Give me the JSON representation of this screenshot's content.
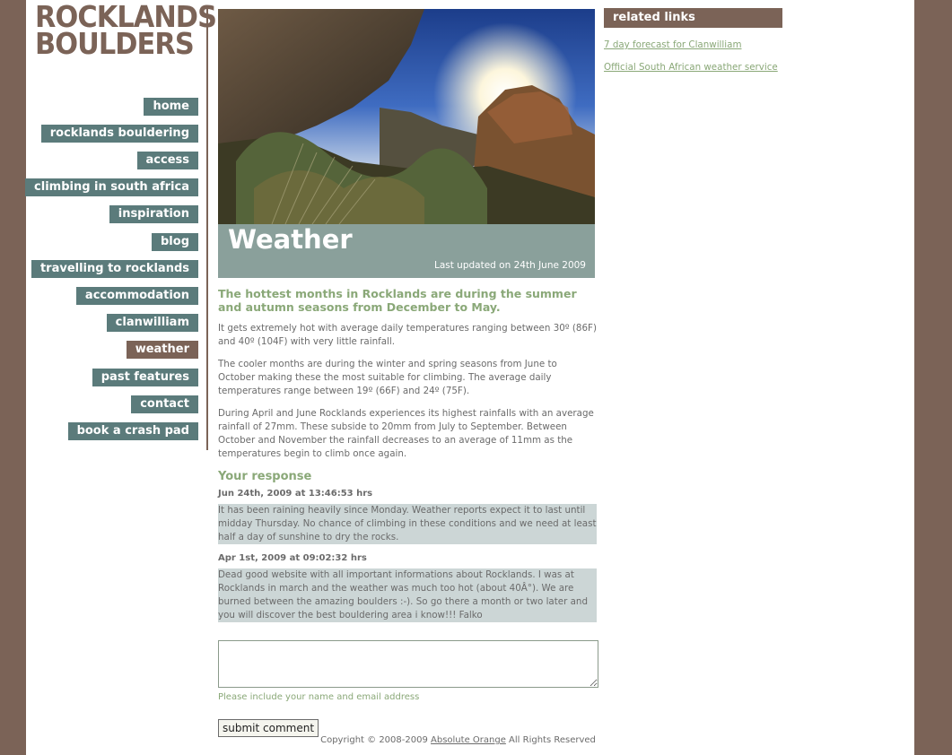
{
  "logo": {
    "line1": "ROCKLANDS",
    "line2": "BOULDERS"
  },
  "nav": [
    {
      "label": "home",
      "active": false
    },
    {
      "label": "rocklands bouldering",
      "active": false
    },
    {
      "label": "access",
      "active": false
    },
    {
      "label": "climbing in south africa",
      "active": false
    },
    {
      "label": "inspiration",
      "active": false
    },
    {
      "label": "blog",
      "active": false
    },
    {
      "label": "travelling to rocklands",
      "active": false
    },
    {
      "label": "accommodation",
      "active": false
    },
    {
      "label": "clanwilliam",
      "active": false
    },
    {
      "label": "weather",
      "active": true
    },
    {
      "label": "past features",
      "active": false
    },
    {
      "label": "contact",
      "active": false
    },
    {
      "label": "book a crash pad",
      "active": false
    }
  ],
  "page": {
    "title": "Weather",
    "updated": "Last updated on 24th June 2009",
    "lead": "The hottest months in Rocklands are during the summer and autumn seasons from December to May.",
    "paragraphs": [
      "It gets extremely hot with average daily temperatures ranging between 30º (86F) and 40º (104F) with very little rainfall.",
      "The cooler months are during the winter and spring seasons from June to October making these the most suitable for climbing. The average daily temperatures range between 19º (66F) and 24º (75F).",
      "During April and June Rocklands experiences its highest rainfalls with an average rainfall of 27mm. These subside to 20mm from July to September. Between October and November the rainfall decreases to an average of 11mm as the temperatures begin to climb once again."
    ]
  },
  "comments": {
    "heading": "Your response",
    "items": [
      {
        "date": "Jun 24th, 2009 at 13:46:53 hrs",
        "body": "It has been raining heavily since Monday. Weather reports expect it to last until midday Thursday. No chance of climbing in these conditions and we need at least half a day of sunshine to dry the rocks."
      },
      {
        "date": "Apr 1st, 2009 at 09:02:32 hrs",
        "body": "Dead good website with all important informations about Rocklands. I was at Rocklands in march and the weather was much too hot (about 40Â°). We are burned between the amazing boulders :-). So go there a month or two later and you will discover the best bouldering area i know!!! Falko"
      }
    ],
    "hint": "Please include your name and email address",
    "submit_label": "submit comment"
  },
  "footer": {
    "prefix": "Copyright © 2008-2009",
    "link": "Absolute Orange",
    "suffix": "All Rights Reserved"
  },
  "related": {
    "heading": "related links",
    "links": [
      "7 day forecast for Clanwilliam",
      "Official South African weather service"
    ]
  },
  "colors": {
    "brown": "#7b6357",
    "teal": "#5b7b7b",
    "green_text": "#8aa878",
    "title_bar": "#8aa09b",
    "comment_bg": "#ccd6d6"
  }
}
